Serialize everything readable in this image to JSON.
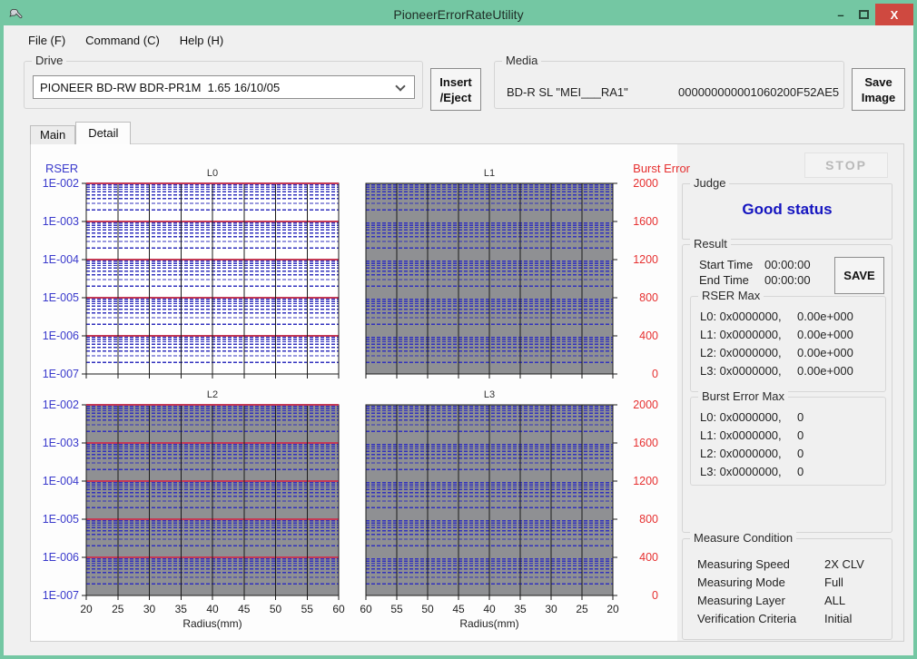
{
  "window": {
    "title": "PioneerErrorRateUtility",
    "controls": {
      "minimize": "–",
      "close": "X"
    }
  },
  "menu": {
    "items": [
      {
        "label": "File (F)"
      },
      {
        "label": "Command (C)"
      },
      {
        "label": "Help (H)"
      }
    ]
  },
  "toolbar": {
    "drive": {
      "group_label": "Drive",
      "selected": "PIONEER BD-RW BDR-PR1M  1.65 16/10/05"
    },
    "insert_eject": {
      "line1": "Insert",
      "line2": "/Eject"
    },
    "media": {
      "group_label": "Media",
      "type": "BD-R SL \"MEI___RA1\"",
      "serial": "000000000001060200F52AE5"
    },
    "save_image": {
      "line1": "Save",
      "line2": "Image"
    }
  },
  "tabs": [
    {
      "label": "Main",
      "active": false
    },
    {
      "label": "Detail",
      "active": true
    }
  ],
  "chart_data": {
    "type": "line",
    "series": [],
    "left_axis": {
      "label": "RSER",
      "scale": "log",
      "ticks": [
        "1E-002",
        "1E-003",
        "1E-004",
        "1E-005",
        "1E-006",
        "1E-007"
      ],
      "color": "#3a3acc"
    },
    "right_axis": {
      "label": "Burst Error",
      "scale": "linear",
      "ticks": [
        "2000",
        "1600",
        "1200",
        "800",
        "400",
        "0"
      ],
      "color": "#e63030"
    },
    "x_axis": {
      "label": "Radius(mm)",
      "ticks": [
        "20",
        "25",
        "30",
        "35",
        "40",
        "45",
        "50",
        "55",
        "60"
      ]
    },
    "charts": [
      {
        "title": "L0",
        "plot_bg": "#ffffff",
        "x_reversed": false,
        "left_ticks": true,
        "right_ticks": false,
        "x_ticks": false,
        "decade_lines": true
      },
      {
        "title": "L1",
        "plot_bg": "#8f9093",
        "x_reversed": true,
        "left_ticks": false,
        "right_ticks": true,
        "x_ticks": false,
        "decade_lines": false
      },
      {
        "title": "L2",
        "plot_bg": "#8f9093",
        "x_reversed": false,
        "left_ticks": true,
        "right_ticks": false,
        "x_ticks": true,
        "decade_lines": true
      },
      {
        "title": "L3",
        "plot_bg": "#8f9093",
        "x_reversed": true,
        "left_ticks": false,
        "right_ticks": true,
        "x_ticks": true,
        "decade_lines": false
      }
    ],
    "colors": {
      "minor_grid": "#3232be",
      "decade_line": "#c43a55",
      "vertical_grid": "#1b1b1b"
    }
  },
  "panel": {
    "stop_label": "STOP",
    "judge": {
      "group_label": "Judge",
      "status": "Good status"
    },
    "result": {
      "group_label": "Result",
      "start_time_label": "Start Time",
      "start_time": "00:00:00",
      "end_time_label": "End Time",
      "end_time": "00:00:00",
      "save_label": "SAVE",
      "rser_max": {
        "group_label": "RSER Max",
        "rows": [
          {
            "label": "L0: 0x0000000,",
            "value": "0.00e+000"
          },
          {
            "label": "L1: 0x0000000,",
            "value": "0.00e+000"
          },
          {
            "label": "L2: 0x0000000,",
            "value": "0.00e+000"
          },
          {
            "label": "L3: 0x0000000,",
            "value": "0.00e+000"
          }
        ]
      },
      "burst_error_max": {
        "group_label": "Burst Error Max",
        "rows": [
          {
            "label": "L0: 0x0000000,",
            "value": "0"
          },
          {
            "label": "L1: 0x0000000,",
            "value": "0"
          },
          {
            "label": "L2: 0x0000000,",
            "value": "0"
          },
          {
            "label": "L3: 0x0000000,",
            "value": "0"
          }
        ]
      }
    },
    "measure_condition": {
      "group_label": "Measure Condition",
      "rows": [
        {
          "label": "Measuring Speed",
          "value": "2X CLV"
        },
        {
          "label": "Measuring Mode",
          "value": "Full"
        },
        {
          "label": "Measuring Layer",
          "value": "ALL"
        },
        {
          "label": "Verification Criteria",
          "value": "Initial"
        }
      ]
    }
  }
}
